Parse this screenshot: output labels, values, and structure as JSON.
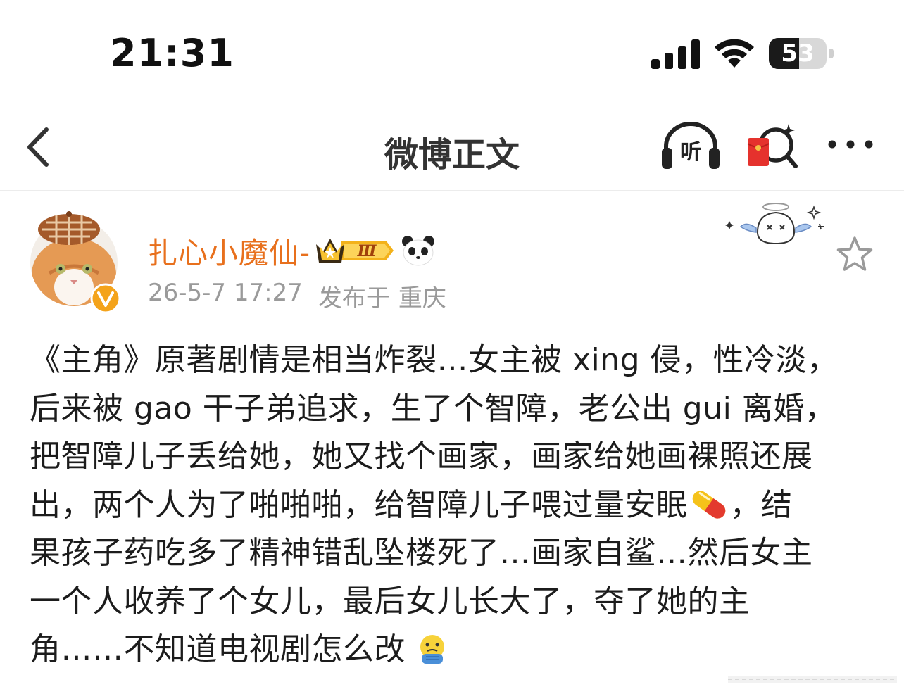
{
  "status_bar": {
    "time": "21:31",
    "battery": "53",
    "battery_level": 0.53
  },
  "nav": {
    "title": "微博正文",
    "listen_label": "听"
  },
  "post": {
    "author": {
      "name": "扎心小魔仙-",
      "vip_level": "Ⅲ"
    },
    "time": "26-5-7 17:27",
    "published_from_label": "发布于",
    "location": "重庆",
    "body_lines": [
      "《主角》原著剧情是相当炸裂…女主被 xing 侵，性冷淡，",
      "后来被 gao 干子弟追求，生了个智障，老公出 gui 离婚，",
      "把智障儿子丢给她，她又找个画家，画家给她画裸照还展",
      "出，两个人为了啪啪啪，给智障儿子喂过量安眠",
      "，结",
      "果孩子药吃多了精神错乱坠楼死了…画家自鲨…然后女主",
      "一个人收养了个女儿，最后女儿长大了，夺了她的主",
      "角……不知道电视剧怎么改"
    ],
    "emojis": [
      "pill-emoji",
      "cold-face-emoji"
    ]
  },
  "colors": {
    "username": "#e8701d",
    "meta": "#9a9a9a",
    "badge_gold": "#f3b21b",
    "verified": "#f4a31a"
  }
}
